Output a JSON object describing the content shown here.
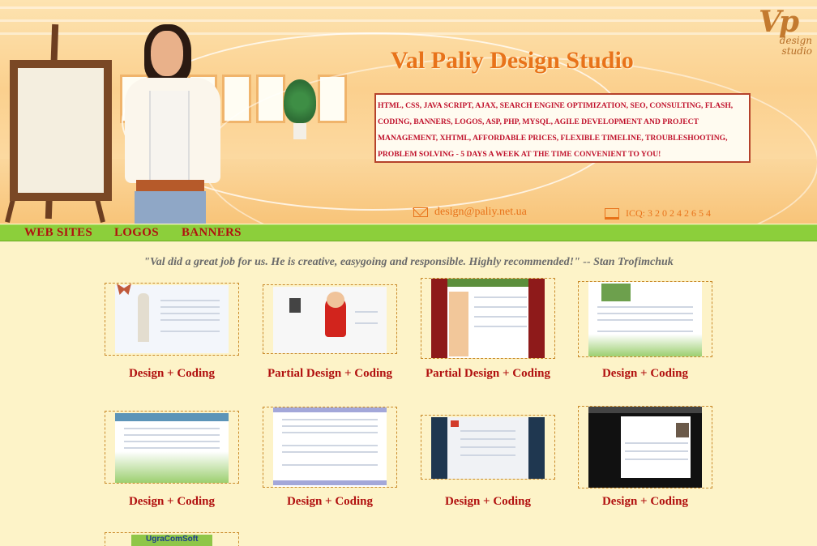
{
  "header": {
    "title": "Val Paliy Design Studio",
    "logo_mark": "Vp",
    "logo_sub1": "design",
    "logo_sub2": "studio",
    "services": "HTML, CSS, JAVA SCRIPT, AJAX, SEARCH ENGINE OPTIMIZATION, SEO, CONSULTING, FLASH, CODING, BANNERS, LOGOS, ASP, PHP, MYSQL, AGILE DEVELOPMENT AND PROJECT MANAGEMENT, XHTML, AFFORDABLE PRICES, FLEXIBLE TIMELINE, TROUBLESHOOTING, PROBLEM SOLVING - 5 DAYS A WEEK AT THE TIME CONVENIENT TO YOU!",
    "email": "design@paliy.net.ua",
    "icq": "ICQ: 3 2 0 2 4 2 6 5 4",
    "email_icon": "mail-envelope-icon",
    "icq_icon": "computer-icon"
  },
  "nav": {
    "items": [
      "WEB SITES",
      "LOGOS",
      "BANNERS"
    ]
  },
  "testimonial": "\"Val did a great job for us. He is creative, easygoing and responsible. Highly recommended!\" -- Stan Trofimchuk",
  "portfolio": [
    {
      "caption": "Design + Coding"
    },
    {
      "caption": "Partial Design + Coding"
    },
    {
      "caption": "Partial Design + Coding"
    },
    {
      "caption": "Design + Coding"
    },
    {
      "caption": "Design + Coding"
    },
    {
      "caption": "Design + Coding"
    },
    {
      "caption": "Design + Coding"
    },
    {
      "caption": "Design + Coding"
    },
    {
      "thumb_text": "UgraComSoft"
    }
  ],
  "colors": {
    "page_bg": "#fdf3c8",
    "nav_bg": "#8ccf3b",
    "link_red": "#b1100f",
    "title_orange": "#e8731a"
  }
}
